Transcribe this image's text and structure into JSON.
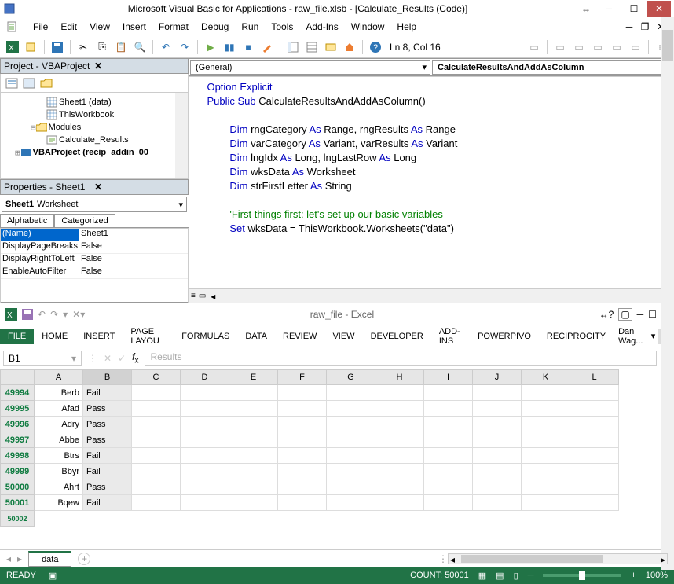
{
  "vba": {
    "title": "Microsoft Visual Basic for Applications - raw_file.xlsb - [Calculate_Results (Code)]",
    "menus": [
      "File",
      "Edit",
      "View",
      "Insert",
      "Format",
      "Debug",
      "Run",
      "Tools",
      "Add-Ins",
      "Window",
      "Help"
    ],
    "position": "Ln 8, Col 16",
    "project_pane_title": "Project - VBAProject",
    "tree": {
      "sheet1": "Sheet1 (data)",
      "thiswb": "ThisWorkbook",
      "modules": "Modules",
      "calcres": "Calculate_Results",
      "vbaproj": "VBAProject (recip_addin_00"
    },
    "properties_title": "Properties - Sheet1",
    "prop_object": "Sheet1 Worksheet",
    "prop_tabs": {
      "alpha": "Alphabetic",
      "cat": "Categorized"
    },
    "props": [
      {
        "name": "(Name)",
        "val": "Sheet1",
        "sel": true
      },
      {
        "name": "DisplayPageBreaks",
        "val": "False"
      },
      {
        "name": "DisplayRightToLeft",
        "val": "False"
      },
      {
        "name": "EnableAutoFilter",
        "val": "False"
      }
    ],
    "dd_left": "(General)",
    "dd_right": "CalculateResultsAndAddAsColumn",
    "code": [
      {
        "t": "Option Explicit",
        "ind": 0,
        "cls": "kw"
      },
      {
        "segments": [
          {
            "t": "Public Sub ",
            "cls": "kw"
          },
          {
            "t": "CalculateResultsAndAddAsColumn()"
          }
        ],
        "ind": 0
      },
      {
        "blank": true
      },
      {
        "segments": [
          {
            "t": "Dim ",
            "cls": "kw"
          },
          {
            "t": "rngCategory "
          },
          {
            "t": "As ",
            "cls": "kw"
          },
          {
            "t": "Range, rngResults "
          },
          {
            "t": "As ",
            "cls": "kw"
          },
          {
            "t": "Range"
          }
        ],
        "ind": 2
      },
      {
        "segments": [
          {
            "t": "Dim ",
            "cls": "kw"
          },
          {
            "t": "varCategory "
          },
          {
            "t": "As ",
            "cls": "kw"
          },
          {
            "t": "Variant, varResults "
          },
          {
            "t": "As ",
            "cls": "kw"
          },
          {
            "t": "Variant"
          }
        ],
        "ind": 2
      },
      {
        "segments": [
          {
            "t": "Dim ",
            "cls": "kw"
          },
          {
            "t": "lngIdx "
          },
          {
            "t": "As ",
            "cls": "kw"
          },
          {
            "t": "Long, lngLastRow "
          },
          {
            "t": "As ",
            "cls": "kw"
          },
          {
            "t": "Long"
          }
        ],
        "ind": 2
      },
      {
        "segments": [
          {
            "t": "Dim ",
            "cls": "kw"
          },
          {
            "t": "wksData "
          },
          {
            "t": "As ",
            "cls": "kw"
          },
          {
            "t": "Worksheet"
          }
        ],
        "ind": 2
      },
      {
        "segments": [
          {
            "t": "Dim ",
            "cls": "kw"
          },
          {
            "t": "strFirstLetter "
          },
          {
            "t": "As ",
            "cls": "kw"
          },
          {
            "t": "String"
          }
        ],
        "ind": 2
      },
      {
        "blank": true
      },
      {
        "t": "'First things first: let's set up our basic variables",
        "ind": 2,
        "cls": "cm"
      },
      {
        "segments": [
          {
            "t": "Set ",
            "cls": "kw"
          },
          {
            "t": "wksData = ThisWorkbook.Worksheets(\"data\")"
          }
        ],
        "ind": 2
      }
    ]
  },
  "excel": {
    "title": "raw_file - Excel",
    "tabs": [
      "FILE",
      "HOME",
      "INSERT",
      "PAGE LAYOU",
      "FORMULAS",
      "DATA",
      "REVIEW",
      "VIEW",
      "DEVELOPER",
      "ADD-INS",
      "POWERPIVO",
      "RECIPROCITY"
    ],
    "user": "Dan Wag...",
    "name_box": "B1",
    "formula": "Results",
    "columns": [
      "A",
      "B",
      "C",
      "D",
      "E",
      "F",
      "G",
      "H",
      "I",
      "J",
      "K",
      "L"
    ],
    "rows": [
      {
        "r": "49994",
        "a": "Berb",
        "b": "Fail"
      },
      {
        "r": "49995",
        "a": "Afad",
        "b": "Pass"
      },
      {
        "r": "49996",
        "a": "Adry",
        "b": "Pass"
      },
      {
        "r": "49997",
        "a": "Abbe",
        "b": "Pass"
      },
      {
        "r": "49998",
        "a": "Btrs",
        "b": "Fail"
      },
      {
        "r": "49999",
        "a": "Bbyr",
        "b": "Fail"
      },
      {
        "r": "50000",
        "a": "Ahrt",
        "b": "Pass"
      },
      {
        "r": "50001",
        "a": "Bqew",
        "b": "Fail"
      }
    ],
    "sheet_tab": "data",
    "status": {
      "ready": "READY",
      "count": "COUNT: 50001",
      "zoom": "100%"
    }
  }
}
